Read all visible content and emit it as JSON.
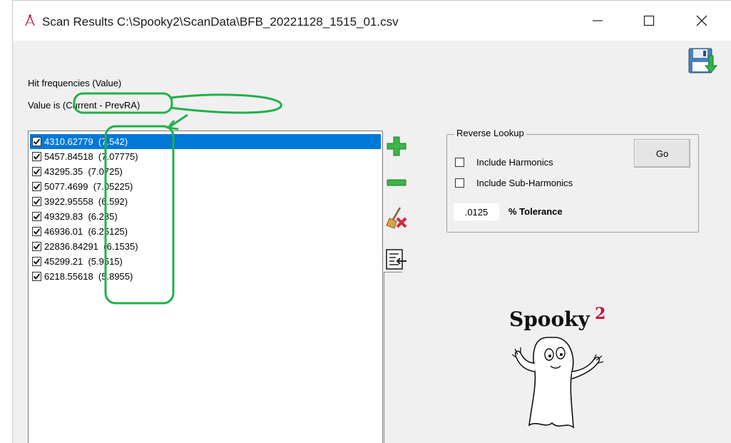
{
  "window": {
    "title": "Scan Results C:\\Spooky2\\ScanData\\BFB_20221128_1515_01.csv",
    "controls": {
      "minimize": "—",
      "maximize": "☐",
      "close": "✕"
    }
  },
  "header": {
    "hit_label": "Hit frequencies (Value)",
    "value_prefix": "Value is",
    "value_mode": "(Current - PrevRA)"
  },
  "list": {
    "items": [
      {
        "frequency": "4310.62779",
        "value": "(7.542)",
        "checked": true,
        "selected": true
      },
      {
        "frequency": "5457.84518",
        "value": "(7.07775)",
        "checked": true,
        "selected": false
      },
      {
        "frequency": "43295.35",
        "value": "(7.0725)",
        "checked": true,
        "selected": false
      },
      {
        "frequency": "5077.4699",
        "value": "(7.05225)",
        "checked": true,
        "selected": false
      },
      {
        "frequency": "3922.95558",
        "value": "(6.592)",
        "checked": true,
        "selected": false
      },
      {
        "frequency": "49329.83",
        "value": "(6.285)",
        "checked": true,
        "selected": false
      },
      {
        "frequency": "46936.01",
        "value": "(6.25125)",
        "checked": true,
        "selected": false
      },
      {
        "frequency": "22836.84291",
        "value": "(6.1535)",
        "checked": true,
        "selected": false
      },
      {
        "frequency": "45299.21",
        "value": "(5.9515)",
        "checked": true,
        "selected": false
      },
      {
        "frequency": "6218.55618",
        "value": "(5.8955)",
        "checked": true,
        "selected": false
      }
    ]
  },
  "toolbar": {
    "add_icon": "plus-icon",
    "remove_icon": "minus-icon",
    "clear_icon": "broom-icon",
    "transfer_icon": "transfer-icon",
    "save_icon": "save-icon"
  },
  "reverse_lookup": {
    "title": "Reverse Lookup",
    "include_harmonics": {
      "label": "Include Harmonics",
      "checked": false
    },
    "include_sub_harmonics": {
      "label": "Include Sub-Harmonics",
      "checked": false
    },
    "go_label": "Go",
    "tolerance_value": ".0125",
    "tolerance_label": "% Tolerance"
  },
  "logo": {
    "text": "Spooky",
    "superscript": "2"
  },
  "colors": {
    "selection": "#0078d7",
    "annotation": "#22b04a",
    "logo_accent": "#c8102e"
  }
}
